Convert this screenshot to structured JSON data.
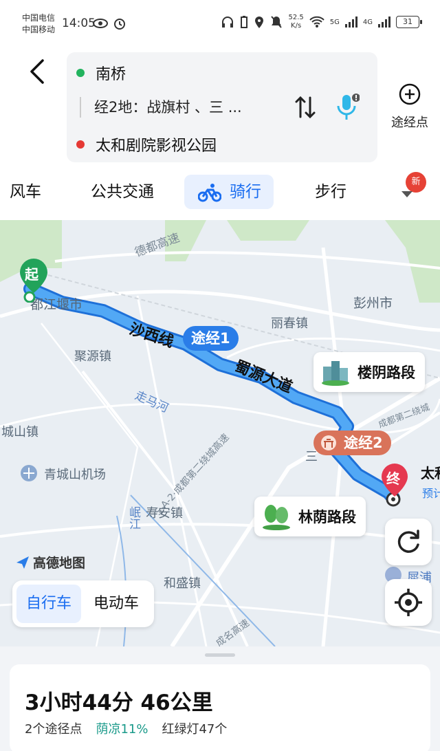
{
  "status_bar": {
    "carrier1": "中国电信",
    "carrier2": "中国移动",
    "time": "14:05",
    "net_speed_value": "52.5",
    "net_speed_unit": "K/s",
    "signal1": "5G",
    "signal2": "4G",
    "battery": "31"
  },
  "route": {
    "origin": "南桥",
    "via": "经2地：战旗村 、三 ...",
    "destination": "太和剧院影视公园",
    "waypoint_label": "途经点"
  },
  "tabs": {
    "tab1": "风车",
    "tab2": "公共交通",
    "tab3_active": "骑行",
    "tab4": "步行",
    "badge": "新"
  },
  "map": {
    "start_pin": "起",
    "end_pin": "终",
    "via1": "途经1",
    "via2": "途经2",
    "road_card1": "楼阴路段",
    "road_card2": "林荫路段",
    "route_label1": "沙西线",
    "route_label2": "蜀源大道",
    "labels": {
      "dujiangyan": "都江堰市",
      "pengzhou": "彭州市",
      "lichun": "丽春镇",
      "juyuan": "聚源镇",
      "zouma": "走马河",
      "chengshan": "城山镇",
      "airport": "青城山机场",
      "minjiang": "岷江",
      "shouan": "寿安镇",
      "hesheng": "和盛镇",
      "dude": "德都高速",
      "sa2": "S-A-2·成都第二绕城高速",
      "chengdu2": "成都第二绕城",
      "taihe_partial": "太和",
      "yuji_partial": "预计",
      "xipu": "犀浦",
      "chengming": "成名高速",
      "san": "三"
    },
    "brand": "高德地图",
    "vehicle_bike": "自行车",
    "vehicle_ebike": "电动车"
  },
  "summary": {
    "duration_distance": "3小时44分  46公里",
    "waypoints": "2个途径点",
    "shade": "荫凉11%",
    "lights": "红绿灯47个"
  },
  "colors": {
    "route_blue": "#2f8cf0",
    "via1_chip": "#2a7de8",
    "via2_chip": "#d9735a",
    "end_pin": "#e53950",
    "start_pin": "#22a35a",
    "accent": "#1a6df0"
  }
}
